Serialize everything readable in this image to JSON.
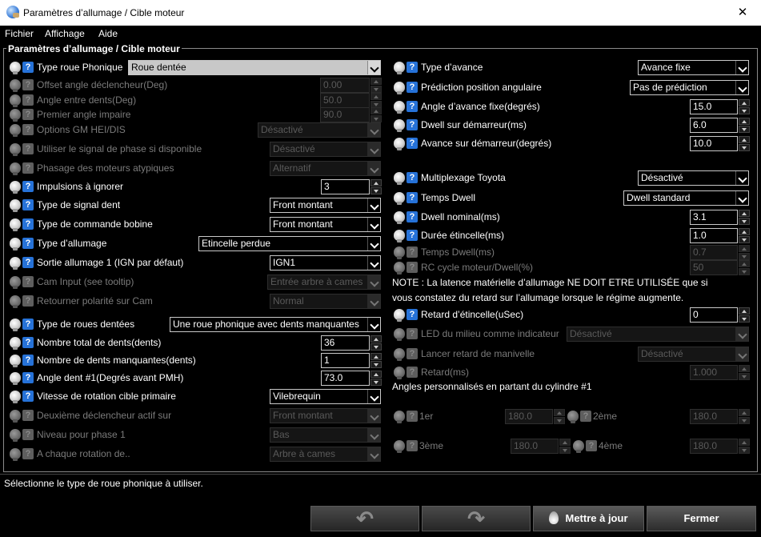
{
  "window": {
    "title": "Paramètres d’allumage / Cible moteur",
    "close": "✕"
  },
  "menu": [
    "Fichier",
    "Affichage",
    "Aide"
  ],
  "group_title": "Paramètres d’allumage / Cible moteur",
  "left": [
    {
      "label": "Type roue Phonique",
      "value": "Roue dentée",
      "kind": "select",
      "enabled": true
    },
    {
      "label": "Offset angle déclencheur(Deg)",
      "value": "0.00",
      "kind": "spin",
      "enabled": false
    },
    {
      "label": "Angle entre dents(Deg)",
      "value": "50.0",
      "kind": "spin",
      "enabled": false
    },
    {
      "label": "Premier angle impaire",
      "value": "90.0",
      "kind": "spin",
      "enabled": false
    },
    {
      "label": "Options GM HEI/DIS",
      "value": "Désactivé",
      "kind": "select",
      "enabled": false
    },
    {
      "label": "Utiliser le signal de phase si disponible",
      "value": "Désactivé",
      "kind": "select",
      "enabled": false
    },
    {
      "label": "Phasage des moteurs atypiques",
      "value": "Alternatif",
      "kind": "select",
      "enabled": false
    },
    {
      "label": "Impulsions à ignorer",
      "value": "3",
      "kind": "spin",
      "enabled": true
    },
    {
      "label": "Type de signal dent",
      "value": "Front montant",
      "kind": "select",
      "enabled": true
    },
    {
      "label": "Type de commande bobine",
      "value": "Front montant",
      "kind": "select",
      "enabled": true
    },
    {
      "label": "Type d’allumage",
      "value": "Etincelle perdue",
      "kind": "select",
      "enabled": true
    },
    {
      "label": "Sortie allumage 1  (IGN par défaut)",
      "value": "IGN1",
      "kind": "select",
      "enabled": true
    },
    {
      "label": "Cam Input (see tooltip)",
      "value": "Entrée arbre à cames",
      "kind": "select",
      "enabled": false
    },
    {
      "label": "Retourner polarité sur Cam",
      "value": "Normal",
      "kind": "select",
      "enabled": false
    },
    {
      "label": "Type de roues dentées",
      "value": "Une roue phonique avec dents manquantes",
      "kind": "select",
      "enabled": true
    },
    {
      "label": "Nombre total de dents(dents)",
      "value": "36",
      "kind": "spin",
      "enabled": true
    },
    {
      "label": "Nombre de dents manquantes(dents)",
      "value": "1",
      "kind": "spin",
      "enabled": true
    },
    {
      "label": "Angle dent #1(Degrés avant PMH)",
      "value": "73.0",
      "kind": "spin",
      "enabled": true
    },
    {
      "label": "Vitesse de rotation cible primaire",
      "value": "Vilebrequin",
      "kind": "select",
      "enabled": true
    },
    {
      "label": "Deuxième déclencheur actif sur",
      "value": "Front montant",
      "kind": "select",
      "enabled": false
    },
    {
      "label": "Niveau pour phase 1",
      "value": "Bas",
      "kind": "select",
      "enabled": false
    },
    {
      "label": "A chaque rotation de..",
      "value": "Arbre à cames",
      "kind": "select",
      "enabled": false
    }
  ],
  "right": [
    {
      "label": "Type d’avance",
      "value": "Avance fixe",
      "kind": "select",
      "enabled": true
    },
    {
      "label": "Prédiction position angulaire",
      "value": "Pas de prédiction",
      "kind": "select",
      "enabled": true
    },
    {
      "label": "Angle d’avance fixe(degrés)",
      "value": "15.0",
      "kind": "spin",
      "enabled": true
    },
    {
      "label": "Dwell sur démarreur(ms)",
      "value": "6.0",
      "kind": "spin",
      "enabled": true
    },
    {
      "label": "Avance sur démarreur(degrés)",
      "value": "10.0",
      "kind": "spin",
      "enabled": true
    },
    {
      "label": "Multiplexage Toyota",
      "value": "Désactivé",
      "kind": "select",
      "enabled": true
    },
    {
      "label": "Temps Dwell",
      "value": "Dwell standard",
      "kind": "select",
      "enabled": true
    },
    {
      "label": "Dwell nominal(ms)",
      "value": "3.1",
      "kind": "spin",
      "enabled": true
    },
    {
      "label": "Durée étincelle(ms)",
      "value": "1.0",
      "kind": "spin",
      "enabled": true
    },
    {
      "label": "Temps Dwell(ms)",
      "value": "0.7",
      "kind": "spin",
      "enabled": false
    },
    {
      "label": "RC cycle moteur/Dwell(%)",
      "value": "50",
      "kind": "spin",
      "enabled": false
    },
    {
      "label": "Retard d’étincelle(uSec)",
      "value": "0",
      "kind": "spin",
      "enabled": true
    },
    {
      "label": "LED du milieu comme indicateur",
      "value": "Désactivé",
      "kind": "select",
      "enabled": false
    },
    {
      "label": "Lancer retard de manivelle",
      "value": "Désactivé",
      "kind": "select",
      "enabled": false
    },
    {
      "label": "Retard(ms)",
      "value": "1.000",
      "kind": "spin",
      "enabled": false
    }
  ],
  "note": {
    "line1": "NOTE : La latence matérielle d’allumage NE DOIT ETRE UTILISÉE que si",
    "line2": "vous constatez du retard sur l’allumage lorsque le régime augmente."
  },
  "angles": {
    "title": "Angles personnalisés en partant du cylindre #1",
    "cylinders": [
      {
        "label": "1er",
        "value": "180.0"
      },
      {
        "label": "2ème",
        "value": "180.0"
      },
      {
        "label": "3ème",
        "value": "180.0"
      },
      {
        "label": "4ème",
        "value": "180.0"
      }
    ]
  },
  "status": "Sélectionne le type de roue phonique à utiliser.",
  "buttons": {
    "undo": "↶",
    "redo": "↷",
    "update": "Mettre à jour",
    "close": "Fermer"
  }
}
